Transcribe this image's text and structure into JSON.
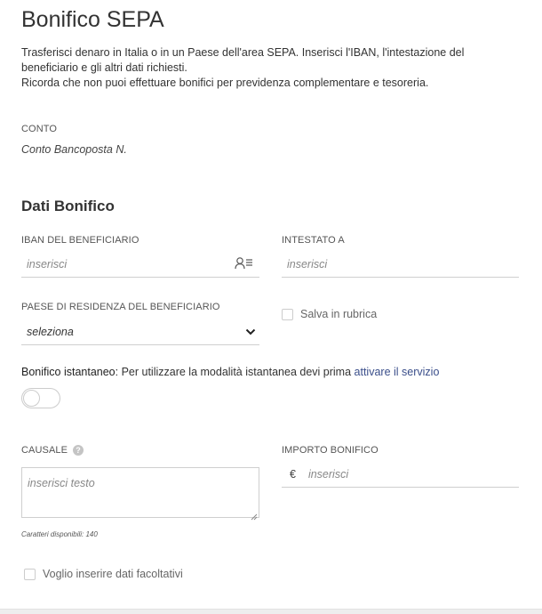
{
  "page": {
    "title": "Bonifico SEPA",
    "intro_line1": "Trasferisci denaro in Italia o in un Paese dell'area SEPA. Inserisci l'IBAN, l'intestazione del",
    "intro_line2": "beneficiario e gli altri dati richiesti.",
    "intro_line3": "Ricorda che non puoi effettuare bonifici per previdenza complementare e tesoreria."
  },
  "account": {
    "label": "CONTO",
    "value": "Conto Bancoposta N."
  },
  "section": {
    "title": "Dati Bonifico"
  },
  "iban": {
    "label": "IBAN DEL BENEFICIARIO",
    "placeholder": "inserisci",
    "icon": "contacts-book-icon"
  },
  "holder": {
    "label": "INTESTATO A",
    "placeholder": "inserisci"
  },
  "country": {
    "label": "PAESE DI RESIDENZA DEL BENEFICIARIO",
    "selected": "seleziona"
  },
  "save_contact": {
    "label": "Salva in rubrica",
    "checked": false
  },
  "instant": {
    "strong": "Bonifico istantaneo",
    "text": ": Per utilizzare la modalità istantanea devi prima ",
    "link": "attivare il servizio",
    "enabled": false
  },
  "reason": {
    "label": "CAUSALE",
    "placeholder": "inserisci testo",
    "chars_label": "Caratteri disponibili: 140"
  },
  "amount": {
    "label": "IMPORTO BONIFICO",
    "currency": "€",
    "placeholder": "inserisci"
  },
  "optional": {
    "label": "Voglio inserire dati facoltativi",
    "checked": false
  },
  "colors": {
    "link": "#3a4e8a",
    "text": "#333333",
    "border": "#cfcfcf"
  }
}
